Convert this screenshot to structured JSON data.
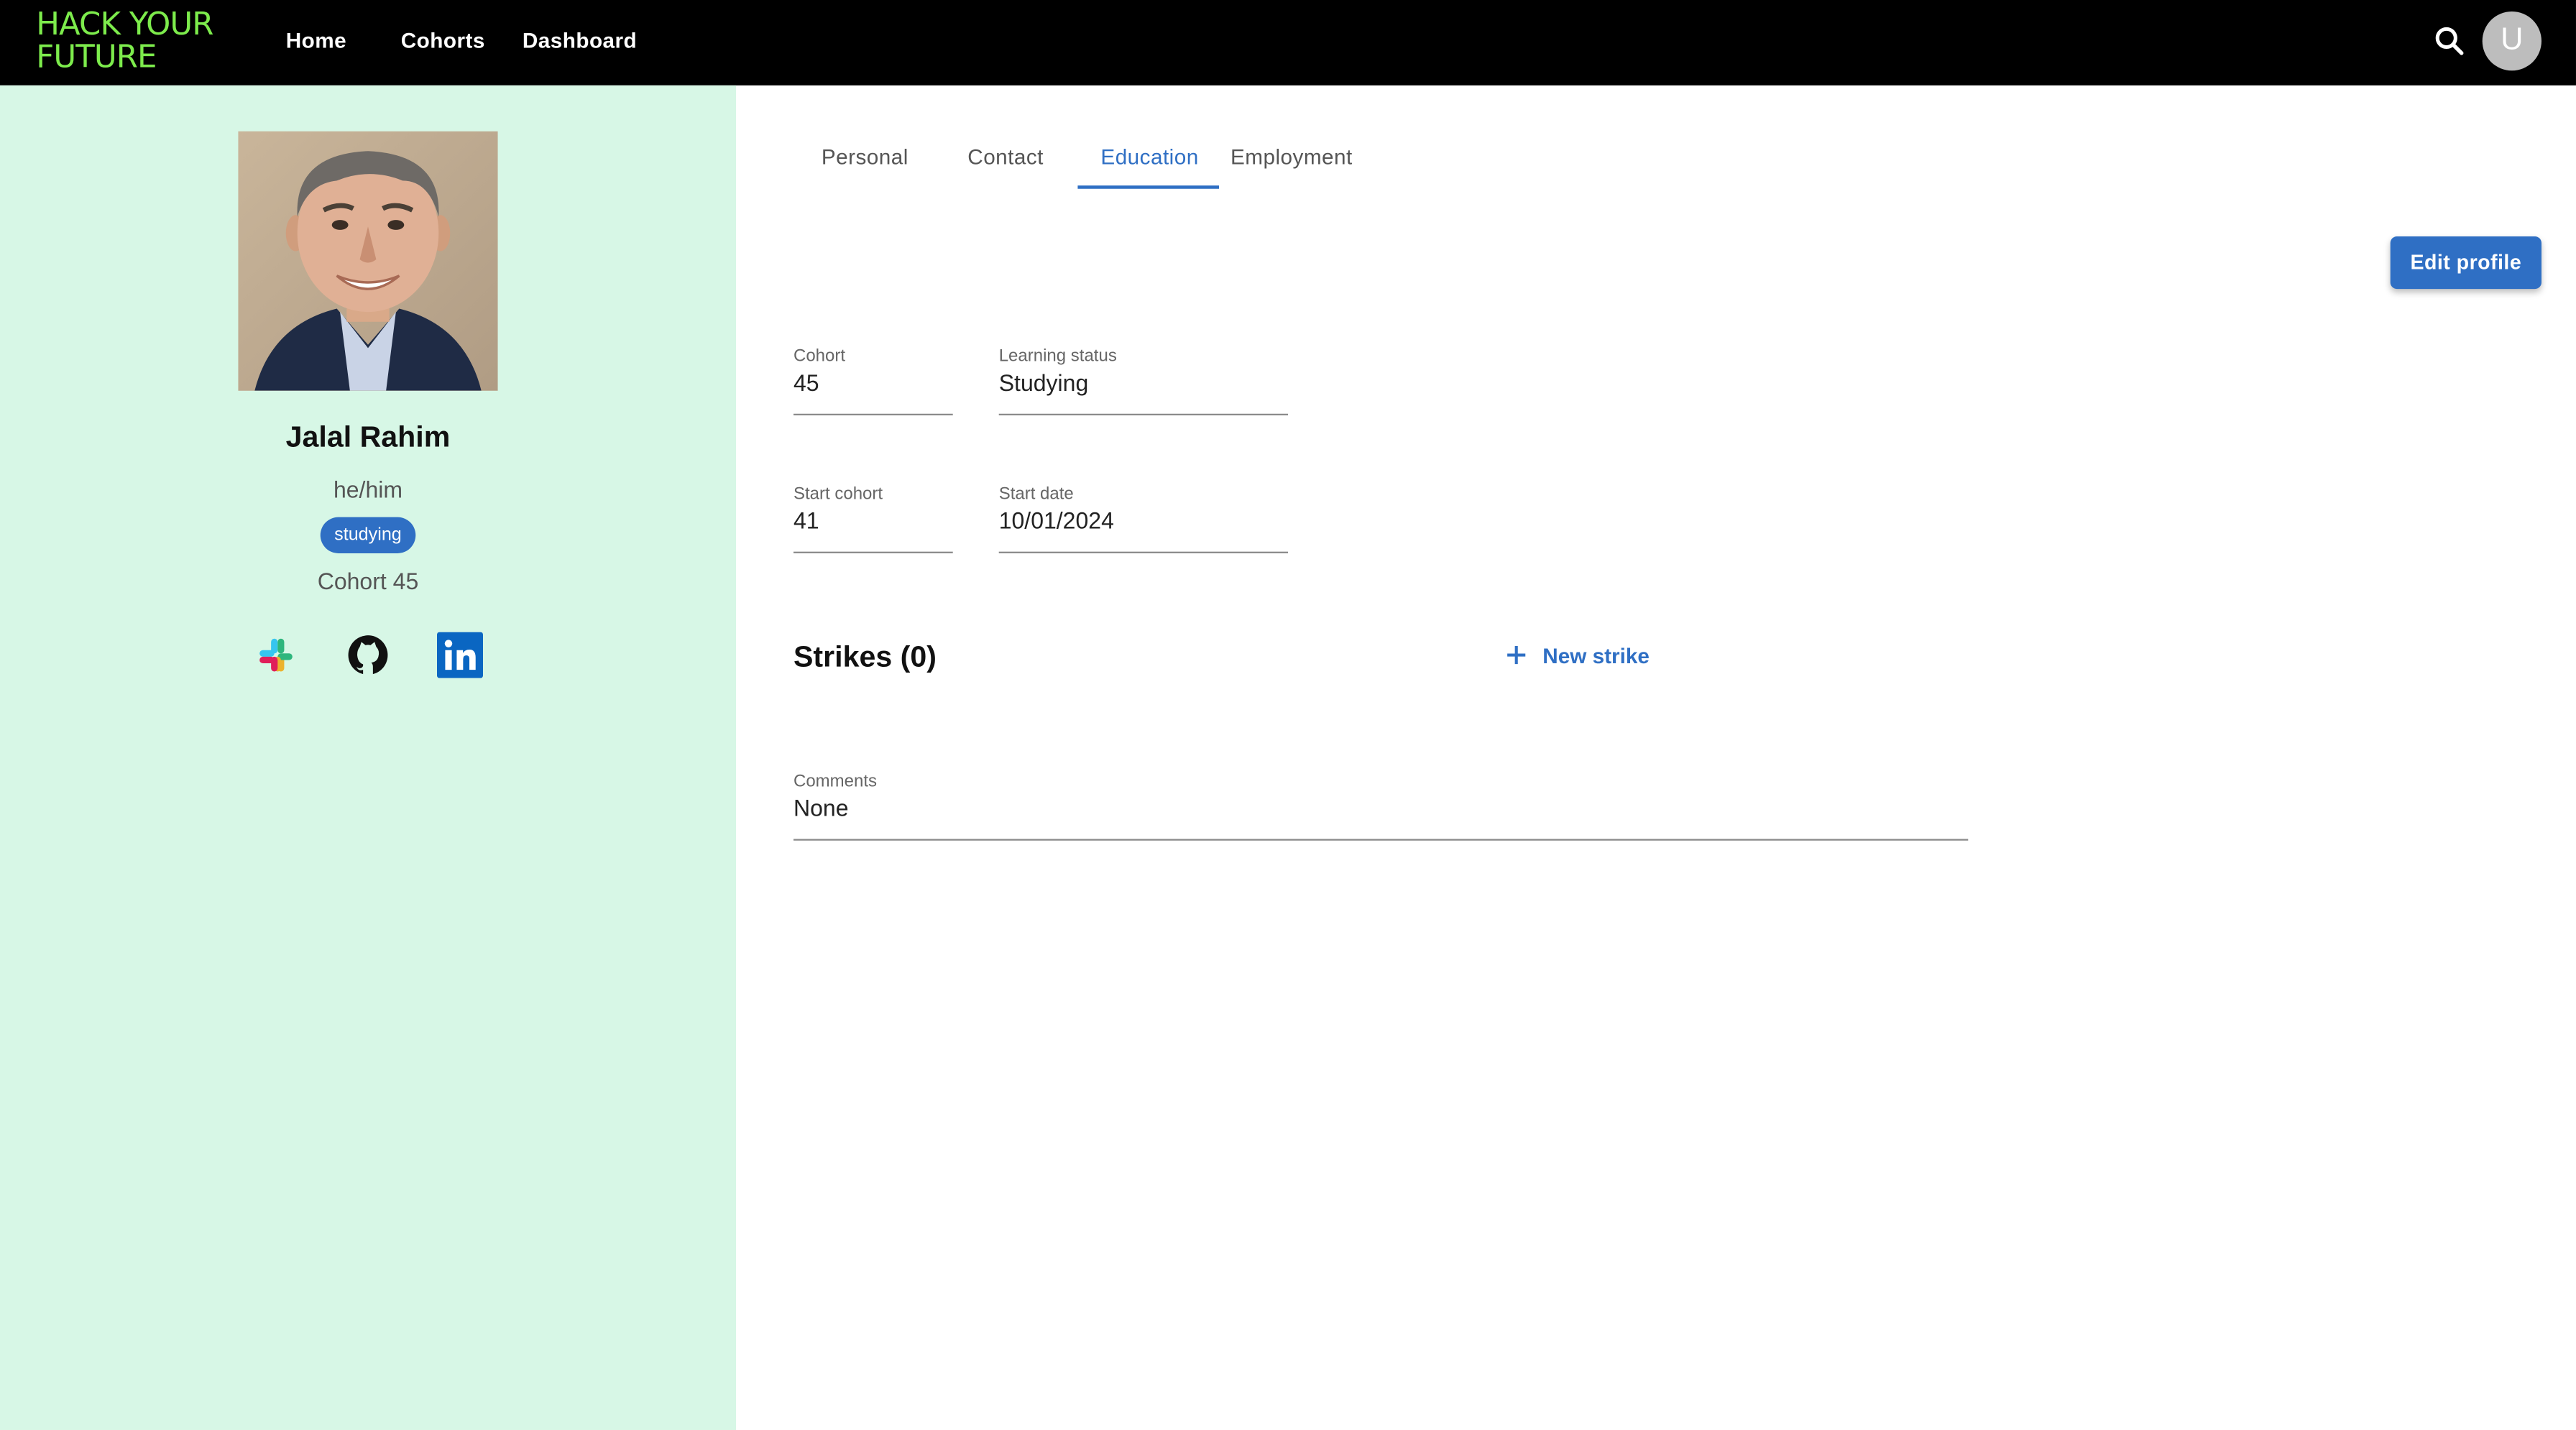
{
  "header": {
    "logo_line1": "HACK YOUR",
    "logo_line2": "FUTURE",
    "nav": [
      "Home",
      "Cohorts",
      "Dashboard"
    ],
    "avatar_initial": "U",
    "search_icon": "search-icon"
  },
  "sidebar": {
    "name": "Jalal Rahim",
    "pronouns": "he/him",
    "status": "studying",
    "cohort": "Cohort 45",
    "social_icons": [
      "slack-icon",
      "github-icon",
      "linkedin-icon"
    ]
  },
  "tabs": [
    {
      "label": "Personal",
      "active": false
    },
    {
      "label": "Contact",
      "active": false
    },
    {
      "label": "Education",
      "active": true
    },
    {
      "label": "Employment",
      "active": false
    }
  ],
  "edit_button": "Edit profile",
  "fields": {
    "cohort": {
      "label": "Cohort",
      "value": "45"
    },
    "learning_status": {
      "label": "Learning status",
      "value": "Studying"
    },
    "start_cohort": {
      "label": "Start cohort",
      "value": "41"
    },
    "start_date": {
      "label": "Start date",
      "value": "10/01/2024"
    },
    "comments": {
      "label": "Comments",
      "value": "None"
    }
  },
  "strikes": {
    "title": "Strikes (0)",
    "new_label": "New strike"
  },
  "colors": {
    "topbar": "#000000",
    "logo": "#7dec4c",
    "sidebar": "#d7f7e6",
    "accent": "#2f6fc4"
  }
}
